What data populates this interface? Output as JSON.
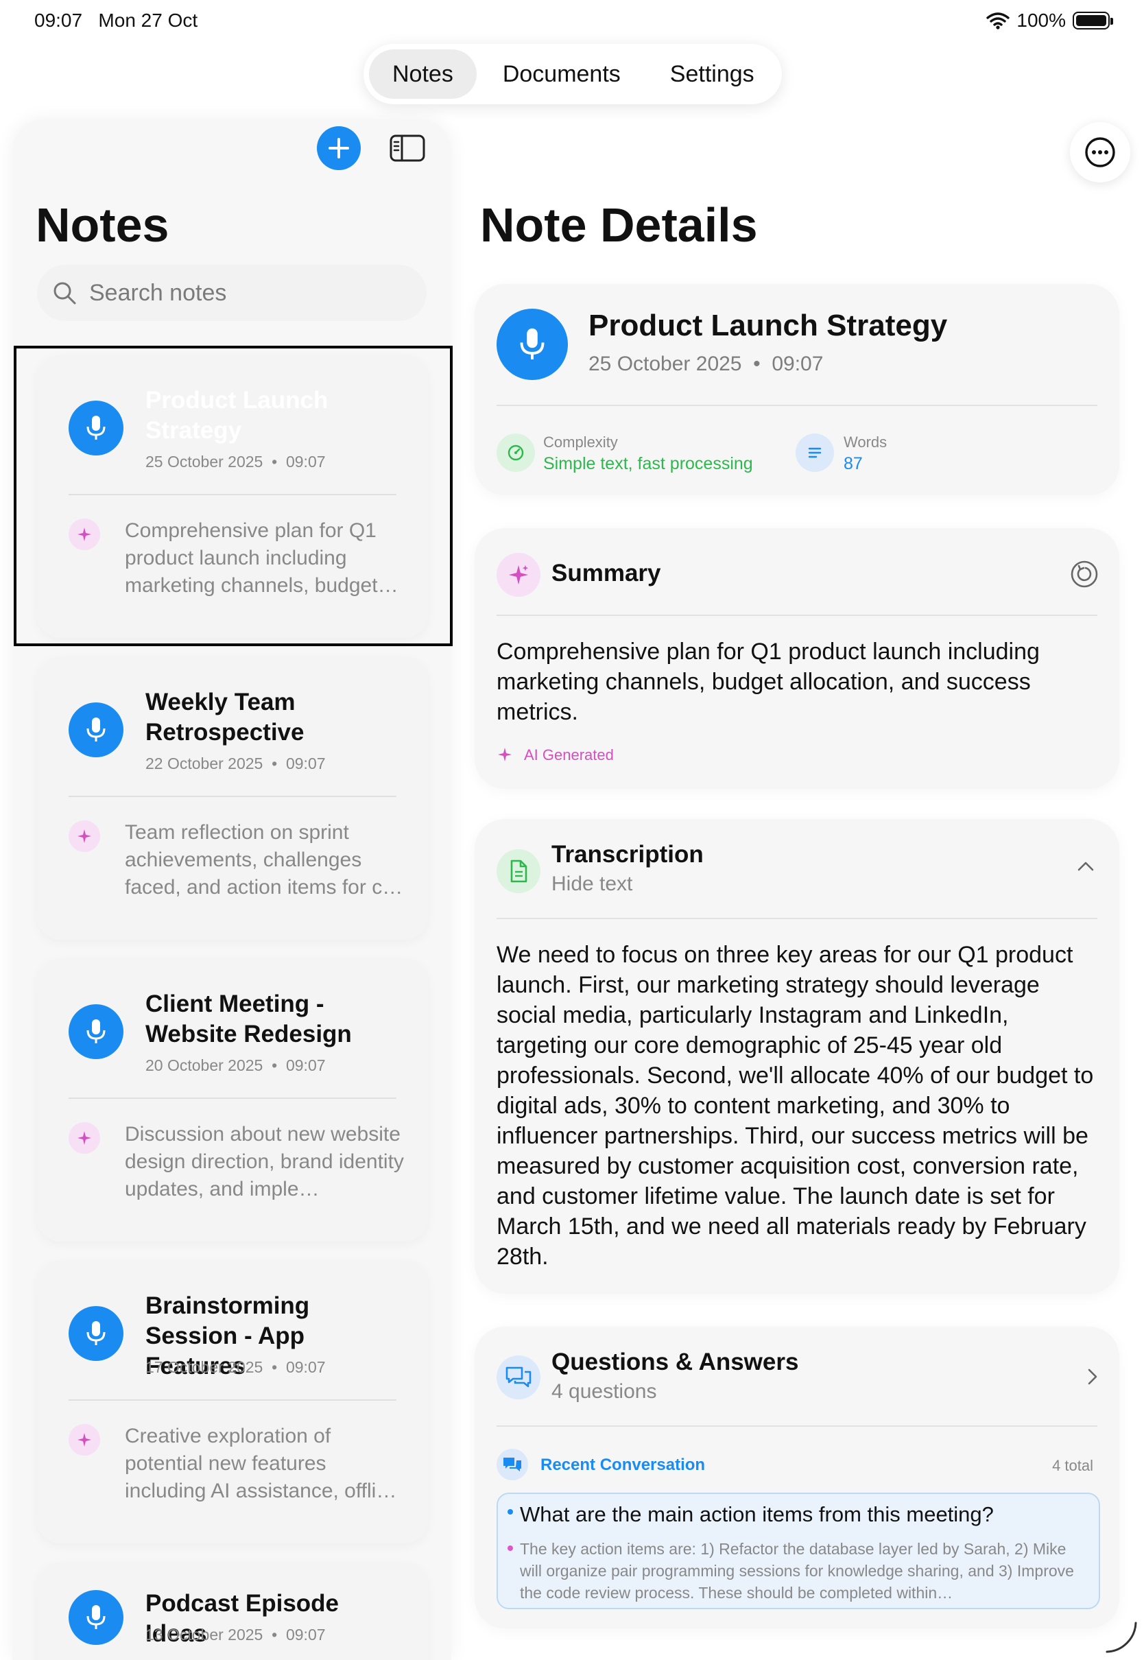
{
  "status": {
    "time": "09:07",
    "date": "Mon 27 Oct",
    "battery": "100%"
  },
  "nav": {
    "tabs": [
      {
        "label": "Notes",
        "active": true
      },
      {
        "label": "Documents",
        "active": false
      },
      {
        "label": "Settings",
        "active": false
      }
    ]
  },
  "sidebar": {
    "title": "Notes",
    "search_placeholder": "Search notes",
    "notes": [
      {
        "title": "Product Launch Strategy",
        "date": "25 October 2025",
        "time": "09:07",
        "summary": "Comprehensive plan for Q1 product launch including marketing channels, budget…",
        "selected": true
      },
      {
        "title": "Weekly Team Retrospective",
        "date": "22 October 2025",
        "time": "09:07",
        "summary": "Team reflection on sprint achievements, challenges faced, and action items for c…"
      },
      {
        "title": "Client Meeting - Website Redesign",
        "date": "20 October 2025",
        "time": "09:07",
        "summary": "Discussion about new website design direction, brand identity updates, and imple…"
      },
      {
        "title": "Brainstorming Session - App Features",
        "date": "17 October 2025",
        "time": "09:07",
        "summary": "Creative exploration of potential new features including AI assistance, offli…"
      },
      {
        "title": "Podcast Episode Ideas",
        "date": "13 October 2025",
        "time": "09:07",
        "summary": ""
      }
    ]
  },
  "detail": {
    "title": "Note Details",
    "note": {
      "title": "Product Launch Strategy",
      "date": "25 October 2025",
      "time": "09:07"
    },
    "stats": {
      "complexity_label": "Complexity",
      "complexity_value": "Simple text, fast processing",
      "words_label": "Words",
      "words_value": "87"
    },
    "summary": {
      "title": "Summary",
      "text": "Comprehensive plan for Q1 product launch including marketing channels, budget allocation, and success metrics.",
      "badge": "AI Generated"
    },
    "transcription": {
      "title": "Transcription",
      "toggle": "Hide text",
      "text": "We need to focus on three key areas for our Q1 product launch. First, our marketing strategy should leverage social media, particularly Instagram and LinkedIn, targeting our core demographic of 25-45 year old professionals. Second, we'll allocate 40% of our budget to digital ads, 30% to content marketing, and 30% to influencer partnerships. Third, our success metrics will be measured by customer acquisition cost, conversion rate, and customer lifetime value. The launch date is set for March 15th, and we need all materials ready by February 28th."
    },
    "qa": {
      "title": "Questions & Answers",
      "count": "4 questions",
      "recent_label": "Recent Conversation",
      "total": "4 total",
      "question": "What are the main action items from this meeting?",
      "answer": "The key action items are: 1) Refactor the database layer led by Sarah, 2) Mike will organize pair programming sessions for knowledge sharing, and 3) Improve the code review process. These should be completed within…"
    }
  },
  "colors": {
    "accent_blue": "#1a8cf1",
    "green": "#2db84d",
    "ai_pink": "#d44fc0"
  }
}
